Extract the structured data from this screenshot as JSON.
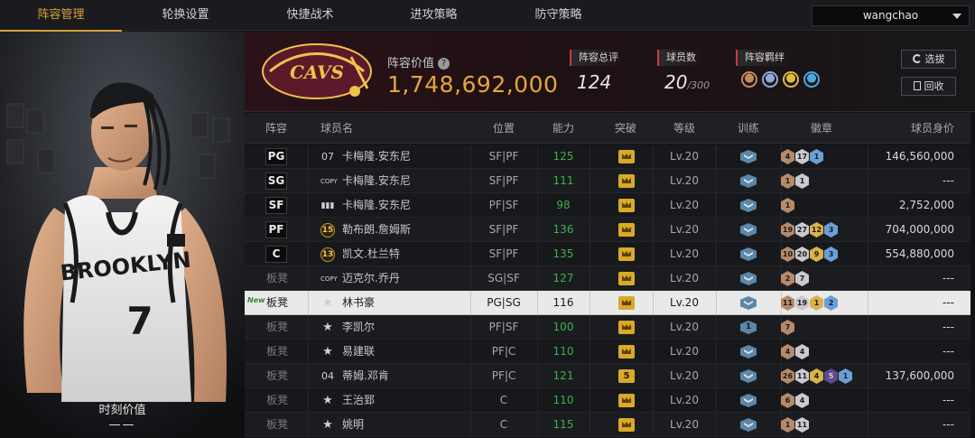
{
  "nav": {
    "tabs": [
      "阵容管理",
      "轮换设置",
      "快捷战术",
      "进攻策略",
      "防守策略"
    ],
    "active_tab": 0,
    "user": "wangchao"
  },
  "player_panel": {
    "market_value_label": "时刻价值",
    "market_value": "——"
  },
  "header": {
    "lineup_value_label": "阵容价值",
    "lineup_value": "1,748,692,000",
    "total_rating_label": "阵容总评",
    "total_rating": "124",
    "player_count_label": "球员数",
    "player_count": "20",
    "player_count_max": "/300",
    "bonds_label": "阵容羁绊",
    "bond_icon_colors": [
      "#c58a5a",
      "#8fa8d8",
      "#e0b840",
      "#4aa8e0"
    ],
    "select_button": "选拔",
    "recycle_button": "回收"
  },
  "table": {
    "headers": [
      "阵容",
      "球员名",
      "位置",
      "能力",
      "突破",
      "等级",
      "训练",
      "徽章",
      "球员身价"
    ],
    "rows": [
      {
        "slot": "PG",
        "slot_type": "starter",
        "mark": "07",
        "mark_type": "plain",
        "name": "卡梅隆.安东尼",
        "position": "SF|PF",
        "ability": "125",
        "breakthrough": "",
        "level": "Lv.20",
        "train": "",
        "badges": [
          {
            "t": "bronze",
            "v": "4"
          },
          {
            "t": "silver",
            "v": "17"
          },
          {
            "t": "blue",
            "v": "1"
          }
        ],
        "value": "146,560,000"
      },
      {
        "slot": "SG",
        "slot_type": "starter",
        "mark": "COPY",
        "mark_type": "copy",
        "name": "卡梅隆.安东尼",
        "position": "SF|PF",
        "ability": "111",
        "breakthrough": "",
        "level": "Lv.20",
        "train": "",
        "badges": [
          {
            "t": "bronze",
            "v": "1"
          },
          {
            "t": "silver",
            "v": "1"
          }
        ],
        "value": "---"
      },
      {
        "slot": "SF",
        "slot_type": "starter",
        "mark": "▮▮▮",
        "mark_type": "bars",
        "name": "卡梅隆.安东尼",
        "position": "PF|SF",
        "ability": "98",
        "breakthrough": "",
        "level": "Lv.20",
        "train": "",
        "badges": [
          {
            "t": "bronze",
            "v": "1"
          }
        ],
        "value": "2,752,000"
      },
      {
        "slot": "PF",
        "slot_type": "starter",
        "mark": "15",
        "mark_type": "gold",
        "name": "勒布朗.詹姆斯",
        "position": "SF|PF",
        "ability": "136",
        "breakthrough": "",
        "level": "Lv.20",
        "train": "",
        "badges": [
          {
            "t": "bronze",
            "v": "19"
          },
          {
            "t": "silver",
            "v": "27"
          },
          {
            "t": "gold",
            "v": "12"
          },
          {
            "t": "blue",
            "v": "3"
          }
        ],
        "value": "704,000,000"
      },
      {
        "slot": "C",
        "slot_type": "starter",
        "mark": "13",
        "mark_type": "gold",
        "name": "凯文.杜兰特",
        "position": "SF|PF",
        "ability": "135",
        "breakthrough": "",
        "level": "Lv.20",
        "train": "",
        "badges": [
          {
            "t": "bronze",
            "v": "10"
          },
          {
            "t": "silver",
            "v": "20"
          },
          {
            "t": "gold",
            "v": "9"
          },
          {
            "t": "blue",
            "v": "3"
          }
        ],
        "value": "554,880,000"
      },
      {
        "slot": "板凳",
        "slot_type": "bench",
        "mark": "COPY",
        "mark_type": "copy",
        "name": "迈克尔.乔丹",
        "position": "SG|SF",
        "ability": "127",
        "breakthrough": "",
        "level": "Lv.20",
        "train": "",
        "badges": [
          {
            "t": "bronze",
            "v": "2"
          },
          {
            "t": "silver",
            "v": "7"
          }
        ],
        "value": "---"
      },
      {
        "slot": "板凳",
        "slot_type": "bench",
        "new": "New",
        "mark": "★",
        "mark_type": "star",
        "name": "林书豪",
        "position": "PG|SG",
        "ability": "116",
        "breakthrough": "",
        "level": "Lv.20",
        "train": "",
        "badges": [
          {
            "t": "bronze",
            "v": "11"
          },
          {
            "t": "silver",
            "v": "19"
          },
          {
            "t": "gold",
            "v": "1"
          },
          {
            "t": "blue",
            "v": "2"
          }
        ],
        "value": "---",
        "selected": true
      },
      {
        "slot": "板凳",
        "slot_type": "bench",
        "mark": "★",
        "mark_type": "star",
        "name": "李凯尔",
        "position": "PF|SF",
        "ability": "100",
        "breakthrough": "",
        "level": "Lv.20",
        "train": "1",
        "badges": [
          {
            "t": "bronze",
            "v": "7"
          }
        ],
        "value": "---"
      },
      {
        "slot": "板凳",
        "slot_type": "bench",
        "mark": "★",
        "mark_type": "star",
        "name": "易建联",
        "position": "PF|C",
        "ability": "110",
        "breakthrough": "",
        "level": "Lv.20",
        "train": "",
        "badges": [
          {
            "t": "bronze",
            "v": "4"
          },
          {
            "t": "silver",
            "v": "4"
          }
        ],
        "value": "---"
      },
      {
        "slot": "板凳",
        "slot_type": "bench",
        "mark": "04",
        "mark_type": "plain",
        "name": "蒂姆.邓肯",
        "position": "PF|C",
        "ability": "121",
        "breakthrough": "5",
        "level": "Lv.20",
        "train": "",
        "badges": [
          {
            "t": "bronze",
            "v": "26"
          },
          {
            "t": "silver",
            "v": "11"
          },
          {
            "t": "gold",
            "v": "4"
          },
          {
            "t": "purple",
            "v": "5"
          },
          {
            "t": "blue",
            "v": "1"
          }
        ],
        "value": "137,600,000"
      },
      {
        "slot": "板凳",
        "slot_type": "bench",
        "mark": "★",
        "mark_type": "star",
        "name": "王治郅",
        "position": "C",
        "ability": "110",
        "breakthrough": "",
        "level": "Lv.20",
        "train": "",
        "badges": [
          {
            "t": "bronze",
            "v": "6"
          },
          {
            "t": "silver",
            "v": "4"
          }
        ],
        "value": "---"
      },
      {
        "slot": "板凳",
        "slot_type": "bench",
        "mark": "★",
        "mark_type": "star",
        "name": "姚明",
        "position": "C",
        "ability": "115",
        "breakthrough": "",
        "level": "Lv.20",
        "train": "",
        "badges": [
          {
            "t": "bronze",
            "v": "1"
          },
          {
            "t": "silver",
            "v": "11"
          }
        ],
        "value": "---"
      }
    ]
  }
}
